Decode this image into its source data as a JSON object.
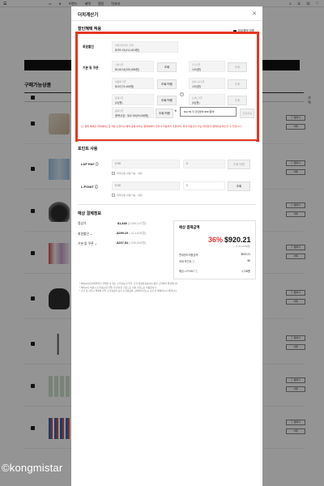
{
  "background": {
    "menu_icon": "hamburger-icon",
    "nav": [
      "▭",
      "B",
      "브랜드",
      "혜택",
      "랭킹",
      "럭셔리"
    ],
    "icons": [
      "search-icon",
      "user-icon",
      "bag-icon",
      "heart-icon"
    ],
    "section_title": "구매가능상품",
    "column_label": "선택",
    "row_button_1": "♡ 찜하기",
    "row_button_2": "삭제"
  },
  "modal": {
    "title": "더치계산기",
    "close_icon": "close-icon",
    "discount_section": {
      "title": "할인혜택 적용",
      "option_label": "최대혜택 적용",
      "member_discount": {
        "label": "회원할인",
        "caption": "회원할인(특가 할인)",
        "value": "$299.19(414,818원)"
      },
      "coupon": {
        "label": "기본 및 쿠폰",
        "field1_caption": "기본쿠폰",
        "field1_value": "$148.04(205,686원)",
        "btn1": "조회",
        "field2_caption": "추가쿠폰",
        "field2_value": "100(원)",
        "btn2": "조회",
        "field3_caption": "상품별 쿠폰",
        "field3_value": "$167(76,466원)",
        "btn3": "조회/적용",
        "field4_caption": "장바구니쿠폰",
        "field4_value": "100(원)",
        "btn4": "조회",
        "field5_caption": "중복쿠폰",
        "field5_value": "(0)(원)",
        "btn5": "조회/적용",
        "field6_caption": "브랜드쿠폰",
        "field6_value": "(0)(원)",
        "btn6": "조회",
        "field7_caption": "중복쿠폰",
        "field7_value": "중복쿠폰 : $42.59(59,058원)",
        "btn7": "조회/적용",
        "tooltip": "$42.59 더 할인받아 $58 절약!",
        "btn8": "조회/적용"
      },
      "warning": "단, 결제 혜택은 최대혜택으로 적용 산정되나 혜택 중복 여부는 결제혜택이 달라서 적용되지 주문되며, 최대 적용산이 되는 최대한의 결제비를 확인할 수 있습니다."
    },
    "points_section": {
      "title": "포인트 사용",
      "ldf_label": "LDF PAY ⓘ",
      "ldf_input1": "0.00",
      "ldf_input2": "0",
      "ldf_button": "조회/적용",
      "ldf_sub": "최대사용 (0원/가능 : 0원)",
      "lpoint_label": "L.POINT ⓘ",
      "lpoint_input1": "0.00",
      "lpoint_input2": "0",
      "lpoint_button": "조회",
      "lpoint_sub": "최대사용 (0원/가능 : 0원)"
    },
    "payment_section": {
      "title": "예상 결제정보",
      "rows": [
        {
          "label": "정상가",
          "value": "$1,448",
          "sub": "(2,066,147원)"
        },
        {
          "label": "회원할인 ⌄",
          "value": "-$299.19",
          "sub": "(-414,818원)"
        },
        {
          "label": "기본 및 쿠폰 ⌄",
          "value": "-$237.54",
          "sub": "(-335,808원)"
        }
      ],
      "summary_title": "예상 결제금액",
      "discount_pct": "36%",
      "final_price": "$920.21",
      "final_krw": "(1,313,039원)",
      "lines": [
        {
          "label": "면세한도적용금액",
          "value": "$920.21"
        },
        {
          "label": "과세 포인트 ⓘ",
          "value": "$0"
        },
        {
          "label": "예상 L.POINT ⓘ",
          "value": "1,718원"
        }
      ]
    },
    "notes": [
      "* 에이씨디(반)/특별할인 금액은 다 있는 출국정보(출국일, 출국 항공편정보(이)) 등을 고려하여 결정합니다.",
      "* 에이씨디 이용시 출국정보(출국일) 및 환율은 기준으로 서울 기준으로 적용됩니다.",
      "* 출국 및 귀국시 결제의 경우 출국정보의 보다 출국정보를 고려하여 반드시 출국 전 결제하시기 바랍니다."
    ]
  },
  "watermark": "©kongmistar"
}
